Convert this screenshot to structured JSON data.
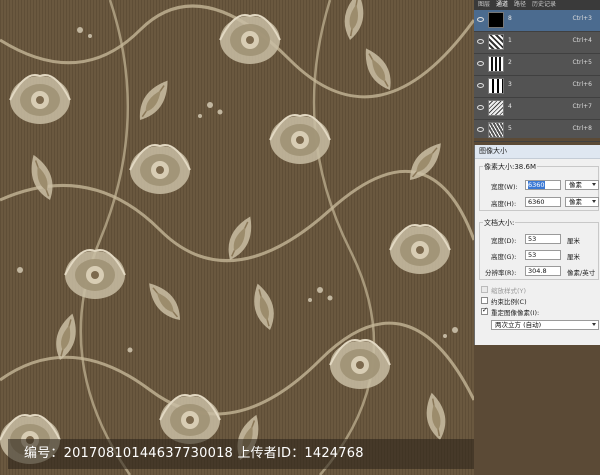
{
  "watermark": {
    "text": "编号：20170810144637730018 上传者ID：1424768"
  },
  "channels_panel": {
    "tabs": [
      "图层",
      "通道",
      "路径",
      "历史记录"
    ],
    "active_tab": 1,
    "channels": [
      {
        "name": "8",
        "shortcut": "Ctrl+3"
      },
      {
        "name": "1",
        "shortcut": "Ctrl+4"
      },
      {
        "name": "2",
        "shortcut": "Ctrl+5"
      },
      {
        "name": "3",
        "shortcut": "Ctrl+6"
      },
      {
        "name": "4",
        "shortcut": "Ctrl+7"
      },
      {
        "name": "5",
        "shortcut": "Ctrl+8"
      }
    ]
  },
  "image_size_dialog": {
    "title": "图像大小",
    "pixel_dims_label": "像素大小:38.6M",
    "width_label": "宽度(W):",
    "width_value": "6360",
    "width_unit": "像素",
    "height_label": "高度(H):",
    "height_value": "6360",
    "height_unit": "像素",
    "doc_size_label": "文档大小:",
    "doc_width_label": "宽度(D):",
    "doc_width_value": "53",
    "doc_width_unit": "厘米",
    "doc_height_label": "高度(G):",
    "doc_height_value": "53",
    "doc_height_unit": "厘米",
    "resolution_label": "分辨率(R):",
    "resolution_value": "304.8",
    "resolution_unit": "像素/英寸",
    "scale_styles": "缩放样式(Y)",
    "constrain": "约束比例(C)",
    "resample": "重定图像像素(I):",
    "resample_method": "两次立方 (自动)"
  }
}
